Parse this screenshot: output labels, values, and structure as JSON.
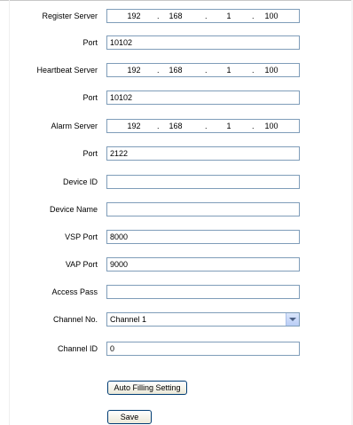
{
  "form": {
    "register_server": {
      "label": "Register Server",
      "octets": [
        "192",
        "168",
        "1",
        "100"
      ]
    },
    "register_port": {
      "label": "Port",
      "value": "10102"
    },
    "heartbeat_server": {
      "label": "Heartbeat Server",
      "octets": [
        "192",
        "168",
        "1",
        "100"
      ]
    },
    "heartbeat_port": {
      "label": "Port",
      "value": "10102"
    },
    "alarm_server": {
      "label": "Alarm Server",
      "octets": [
        "192",
        "168",
        "1",
        "100"
      ]
    },
    "alarm_port": {
      "label": "Port",
      "value": "2122"
    },
    "device_id": {
      "label": "Device ID",
      "value": ""
    },
    "device_name": {
      "label": "Device Name",
      "value": ""
    },
    "vsp_port": {
      "label": "VSP Port",
      "value": "8000"
    },
    "vap_port": {
      "label": "VAP Port",
      "value": "9000"
    },
    "access_pass": {
      "label": "Access Pass",
      "value": ""
    },
    "channel_no": {
      "label": "Channel No.",
      "selected": "Channel 1"
    },
    "channel_id": {
      "label": "Channel ID",
      "value": "0"
    },
    "ip_separator": "."
  },
  "buttons": {
    "auto_fill": "Auto Filling Setting",
    "save": "Save"
  },
  "icons": {
    "dropdown": "chevron-down-icon"
  }
}
